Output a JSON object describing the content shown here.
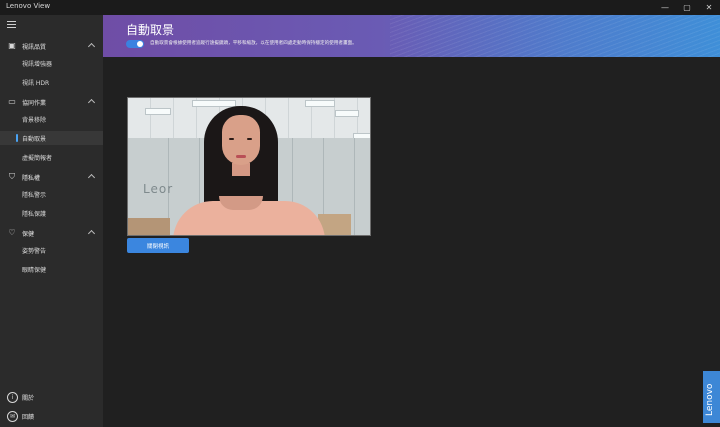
{
  "window": {
    "title": "Lenovo View",
    "controls": [
      "minimize",
      "maximize",
      "close"
    ]
  },
  "sidebar": {
    "sections": [
      {
        "label": "視訊品質",
        "icon": "video-quality-icon",
        "items": [
          {
            "label": "視訊增強器"
          },
          {
            "label": "視訊 HDR"
          }
        ]
      },
      {
        "label": "協同作業",
        "icon": "collaboration-icon",
        "items": [
          {
            "label": "背景移除"
          },
          {
            "label": "自動取景",
            "active": true
          },
          {
            "label": "虛擬簡報者"
          }
        ]
      },
      {
        "label": "隱私權",
        "icon": "privacy-icon",
        "items": [
          {
            "label": "隱私警示"
          },
          {
            "label": "隱私保護"
          }
        ]
      },
      {
        "label": "保健",
        "icon": "health-icon",
        "items": [
          {
            "label": "姿勢警告"
          },
          {
            "label": "眼睛保健"
          }
        ]
      }
    ],
    "bottom": [
      {
        "label": "關於",
        "icon": "info-icon"
      },
      {
        "label": "回饋",
        "icon": "feedback-icon"
      }
    ]
  },
  "header": {
    "title": "自動取景",
    "toggle_on": true,
    "description": "自動取景會根據使用者追蹤行遠擬鏡頭，平移和縮放，以在使用者四處走動時保持穩定的使用者畫面。"
  },
  "camera": {
    "button_label": "關閉視訊"
  },
  "brand": {
    "tab_text": "Lenovo"
  },
  "colors": {
    "accent": "#3b86df",
    "sidebar_bg": "#2b2b2b",
    "main_bg": "#202020"
  }
}
